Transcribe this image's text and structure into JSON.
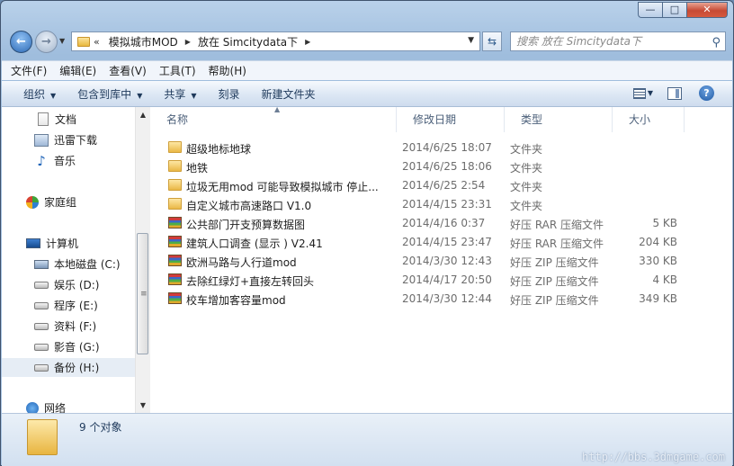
{
  "caption": {
    "minimize": "—",
    "maximize": "□",
    "close": "✕"
  },
  "address": {
    "breadcrumb_prefix": "«",
    "crumbs": [
      "模拟城市MOD",
      "放在 Simcitydata下"
    ],
    "separator": "▶",
    "dropdown": "▼",
    "refresh": "⇆"
  },
  "search": {
    "placeholder": "搜索 放在 Simcitydata下",
    "icon": "search-icon"
  },
  "menu": [
    "文件(F)",
    "编辑(E)",
    "查看(V)",
    "工具(T)",
    "帮助(H)"
  ],
  "toolbar": {
    "organize": "组织",
    "include_in_library": "包含到库中",
    "share": "共享",
    "burn": "刻录",
    "new_folder": "新建文件夹",
    "help": "?"
  },
  "sidebar": {
    "items": [
      {
        "label": "文档",
        "icon": "document-icon"
      },
      {
        "label": "迅雷下载",
        "icon": "download-folder-icon"
      },
      {
        "label": "音乐",
        "icon": "music-icon"
      },
      {
        "label": "家庭组",
        "icon": "homegroup-icon"
      },
      {
        "label": "计算机",
        "icon": "computer-icon"
      },
      {
        "label": "本地磁盘 (C:)",
        "icon": "system-drive-icon"
      },
      {
        "label": "娱乐 (D:)",
        "icon": "drive-icon"
      },
      {
        "label": "程序 (E:)",
        "icon": "drive-icon"
      },
      {
        "label": "资料 (F:)",
        "icon": "drive-icon"
      },
      {
        "label": "影音 (G:)",
        "icon": "drive-icon"
      },
      {
        "label": "备份 (H:)",
        "icon": "drive-icon",
        "selected": true
      },
      {
        "label": "网络",
        "icon": "network-icon"
      }
    ]
  },
  "columns": {
    "name": "名称",
    "date": "修改日期",
    "type": "类型",
    "size": "大小"
  },
  "files": [
    {
      "name": "超级地标地球",
      "date": "2014/6/25 18:07",
      "type": "文件夹",
      "size": "",
      "icon": "folder-icon"
    },
    {
      "name": "地铁",
      "date": "2014/6/25 18:06",
      "type": "文件夹",
      "size": "",
      "icon": "folder-icon"
    },
    {
      "name": "垃圾无用mod  可能导致模拟城市 停止...",
      "date": "2014/6/25 2:54",
      "type": "文件夹",
      "size": "",
      "icon": "folder-icon"
    },
    {
      "name": "自定义城市高速路口 V1.0",
      "date": "2014/4/15 23:31",
      "type": "文件夹",
      "size": "",
      "icon": "folder-icon"
    },
    {
      "name": "公共部门开支预算数据图",
      "date": "2014/4/16 0:37",
      "type": "好压 RAR 压缩文件",
      "size": "5 KB",
      "icon": "archive-icon"
    },
    {
      "name": "建筑人口调查 (显示 ) V2.41",
      "date": "2014/4/15 23:47",
      "type": "好压 RAR 压缩文件",
      "size": "204 KB",
      "icon": "archive-icon"
    },
    {
      "name": "欧洲马路与人行道mod",
      "date": "2014/3/30 12:43",
      "type": "好压 ZIP 压缩文件",
      "size": "330 KB",
      "icon": "archive-icon"
    },
    {
      "name": "去除红绿灯+直接左转回头",
      "date": "2014/4/17 20:50",
      "type": "好压 ZIP 压缩文件",
      "size": "4 KB",
      "icon": "archive-icon"
    },
    {
      "name": "校车增加客容量mod",
      "date": "2014/3/30 12:44",
      "type": "好压 ZIP 压缩文件",
      "size": "349 KB",
      "icon": "archive-icon"
    }
  ],
  "details": {
    "object_count": "9 个对象"
  },
  "watermark": "http://bbs.3dmgame.com"
}
